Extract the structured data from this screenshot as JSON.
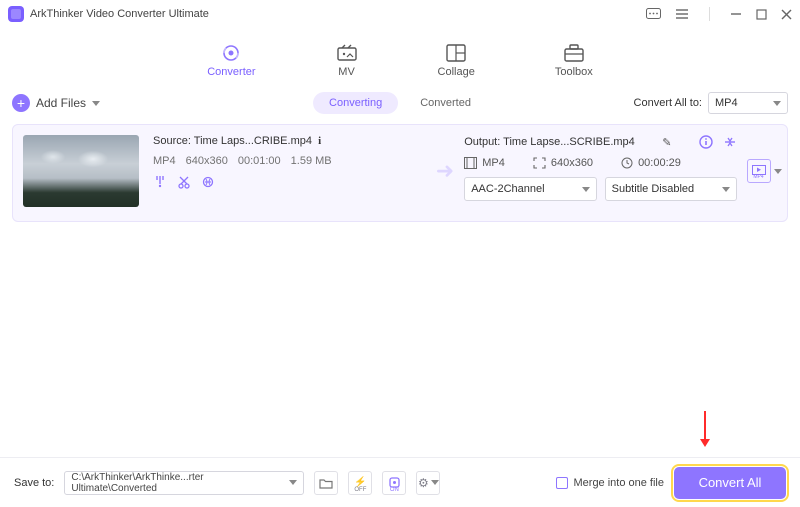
{
  "titlebar": {
    "title": "ArkThinker Video Converter Ultimate"
  },
  "nav": {
    "converter": "Converter",
    "mv": "MV",
    "collage": "Collage",
    "toolbox": "Toolbox"
  },
  "toolbar": {
    "add_files": "Add Files"
  },
  "segments": {
    "converting": "Converting",
    "converted": "Converted"
  },
  "convert_all": {
    "label": "Convert All to:",
    "value": "MP4"
  },
  "file": {
    "source_label": "Source:",
    "source_name": "Time Laps...CRIBE.mp4",
    "format": "MP4",
    "resolution": "640x360",
    "duration": "00:01:00",
    "size": "1.59 MB",
    "output_label": "Output:",
    "output_name": "Time Lapse...SCRIBE.mp4",
    "out_fmt": "MP4",
    "out_res": "640x360",
    "out_dur": "00:00:29",
    "audio_select": "AAC-2Channel",
    "subtitle_select": "Subtitle Disabled"
  },
  "footer": {
    "save_to_label": "Save to:",
    "save_path": "C:\\ArkThinker\\ArkThinke...rter Ultimate\\Converted",
    "merge_label": "Merge into one file",
    "convert_button": "Convert All"
  }
}
